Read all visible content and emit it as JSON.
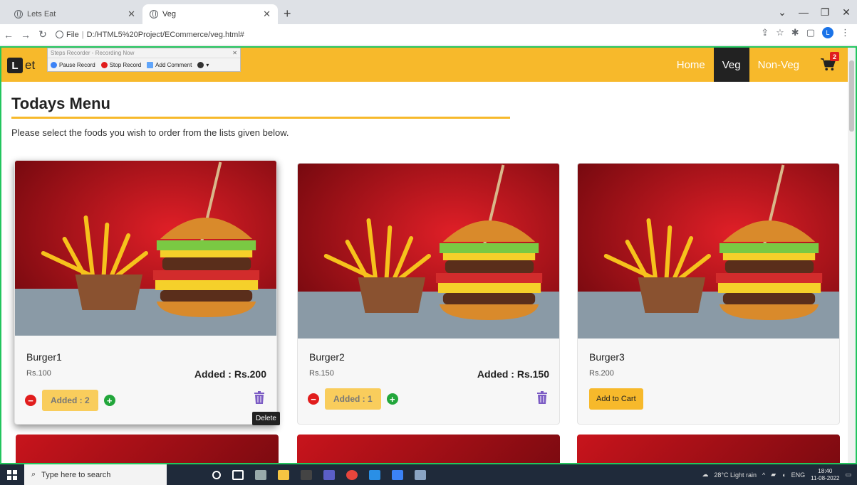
{
  "browser": {
    "tabs": [
      {
        "title": "Lets Eat",
        "active": false
      },
      {
        "title": "Veg",
        "active": true
      }
    ],
    "new_tab": "+",
    "url_scheme": "File",
    "url_path": "D:/HTML5%20Project/ECommerce/veg.html#",
    "profile_initial": "L"
  },
  "recorder": {
    "title": "Steps Recorder - Recording Now",
    "pause": "Pause Record",
    "stop": "Stop Record",
    "comment": "Add Comment"
  },
  "navbar": {
    "brand_letter": "L",
    "brand_text": "et",
    "links": {
      "home": "Home",
      "veg": "Veg",
      "nonveg": "Non-Veg"
    },
    "cart_count": "2"
  },
  "page": {
    "title": "Todays Menu",
    "subtitle": "Please select the foods you wish to order from the lists given below."
  },
  "cards": [
    {
      "name": "Burger1",
      "price": "Rs.100",
      "total": "Added : Rs.200",
      "qty": "Added : 2"
    },
    {
      "name": "Burger2",
      "price": "Rs.150",
      "total": "Added : Rs.150",
      "qty": "Added : 1"
    },
    {
      "name": "Burger3",
      "price": "Rs.200",
      "button": "Add to Cart"
    }
  ],
  "tooltip": "Delete",
  "taskbar": {
    "search_placeholder": "Type here to search",
    "weather": "28°C Light rain",
    "lang": "ENG",
    "time": "18:40",
    "date": "11-08-2022"
  },
  "colors": {
    "accent": "#f7b92b",
    "frame": "#22c55e",
    "danger": "#e11d1d",
    "success": "#22a63b"
  }
}
